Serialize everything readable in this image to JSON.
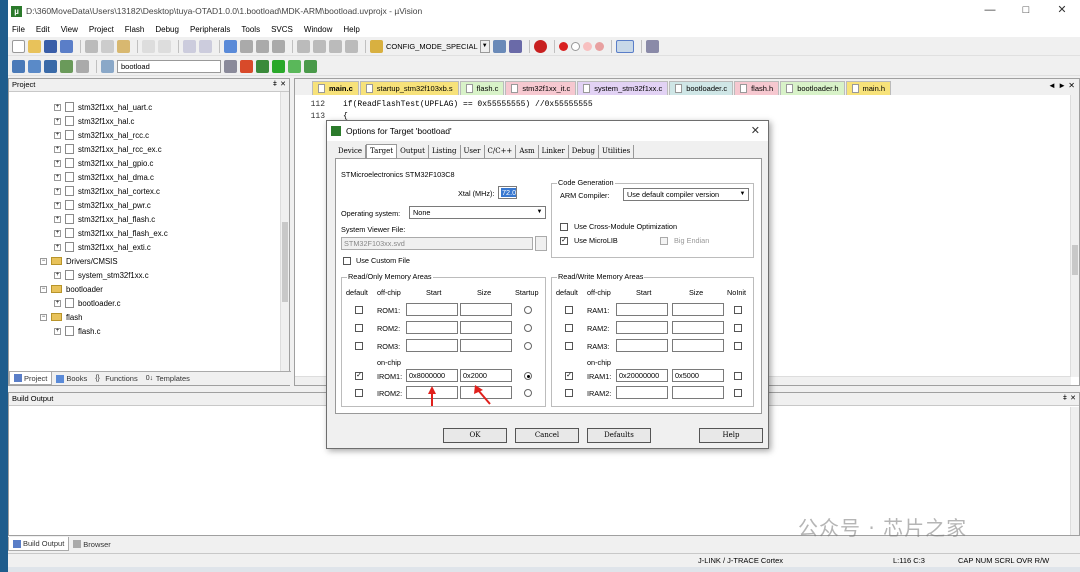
{
  "window": {
    "title": "D:\\360MoveData\\Users\\13182\\Desktop\\tuya-OTAD1.0.0\\1.bootload\\MDK-ARM\\bootload.uvprojx - µVision",
    "controls": [
      "—",
      "□",
      "✕"
    ]
  },
  "menu": [
    "File",
    "Edit",
    "View",
    "Project",
    "Flash",
    "Debug",
    "Peripherals",
    "Tools",
    "SVCS",
    "Window",
    "Help"
  ],
  "toolbar": {
    "config_label": "CONFIG_MODE_SPECIAL",
    "target": "bootload"
  },
  "project": {
    "title": "Project",
    "items": [
      {
        "label": "stm32f1xx_hal_uart.c",
        "kind": "file"
      },
      {
        "label": "stm32f1xx_hal.c",
        "kind": "file"
      },
      {
        "label": "stm32f1xx_hal_rcc.c",
        "kind": "file"
      },
      {
        "label": "stm32f1xx_hal_rcc_ex.c",
        "kind": "file"
      },
      {
        "label": "stm32f1xx_hal_gpio.c",
        "kind": "file"
      },
      {
        "label": "stm32f1xx_hal_dma.c",
        "kind": "file"
      },
      {
        "label": "stm32f1xx_hal_cortex.c",
        "kind": "file"
      },
      {
        "label": "stm32f1xx_hal_pwr.c",
        "kind": "file"
      },
      {
        "label": "stm32f1xx_hal_flash.c",
        "kind": "file"
      },
      {
        "label": "stm32f1xx_hal_flash_ex.c",
        "kind": "file"
      },
      {
        "label": "stm32f1xx_hal_exti.c",
        "kind": "file"
      },
      {
        "label": "Drivers/CMSIS",
        "kind": "folder"
      },
      {
        "label": "system_stm32f1xx.c",
        "kind": "file"
      },
      {
        "label": "bootloader",
        "kind": "folder"
      },
      {
        "label": "bootloader.c",
        "kind": "file"
      },
      {
        "label": "flash",
        "kind": "folder"
      },
      {
        "label": "flash.c",
        "kind": "file"
      }
    ],
    "tabs": [
      "Project",
      "Books",
      "Functions",
      "Templates"
    ]
  },
  "editor": {
    "tabs": [
      {
        "label": "main.c",
        "color": "#f7e27a"
      },
      {
        "label": "startup_stm32f103xb.s",
        "color": "#f7e27a"
      },
      {
        "label": "flash.c",
        "color": "#d8f2c8"
      },
      {
        "label": "stm32f1xx_it.c",
        "color": "#f6c8d0"
      },
      {
        "label": "system_stm32f1xx.c",
        "color": "#e2d2f4"
      },
      {
        "label": "bootloader.c",
        "color": "#cfe6e6"
      },
      {
        "label": "flash.h",
        "color": "#f6c8d0"
      },
      {
        "label": "bootloader.h",
        "color": "#d8f2c8"
      },
      {
        "label": "main.h",
        "color": "#f7e27a"
      }
    ],
    "lines": [
      {
        "num": "112",
        "code": "if(ReadFlashTest(UPFLAG) == 0x55555555)  //0x55555555"
      },
      {
        "num": "113",
        "code": "{"
      }
    ]
  },
  "build": {
    "title": "Build Output",
    "tabs": [
      "Build Output",
      "Browser"
    ]
  },
  "status": {
    "debugger": "J-LINK / J-TRACE Cortex",
    "position": "L:116 C:3",
    "flags": "CAP  NUM  SCRL  OVR  R/W"
  },
  "watermark": "公众号 · 芯片之家",
  "dialog": {
    "title": "Options for Target 'bootload'",
    "tabs": [
      "Device",
      "Target",
      "Output",
      "Listing",
      "User",
      "C/C++",
      "Asm",
      "Linker",
      "Debug",
      "Utilities"
    ],
    "device": "STMicroelectronics STM32F103C8",
    "xtal_label": "Xtal (MHz):",
    "xtal": "72.0",
    "os_label": "Operating system:",
    "os": "None",
    "svd_label": "System Viewer File:",
    "svd": "STM32F103xx.svd",
    "custom_file": "Use Custom File",
    "codegen": {
      "title": "Code Generation",
      "compiler_label": "ARM Compiler:",
      "compiler": "Use default compiler version",
      "cross": "Use Cross-Module Optimization",
      "microlib": "Use MicroLIB",
      "bigendian": "Big Endian"
    },
    "ro": {
      "title": "Read/Only Memory Areas",
      "h_default": "default",
      "h_offchip": "off-chip",
      "h_start": "Start",
      "h_size": "Size",
      "h_startup": "Startup",
      "rows": [
        "ROM1:",
        "ROM2:",
        "ROM3:"
      ],
      "onchip": "on-chip",
      "irom1": "IROM1:",
      "irom1_start": "0x8000000",
      "irom1_size": "0x2000",
      "irom2": "IROM2:"
    },
    "rw": {
      "title": "Read/Write Memory Areas",
      "h_default": "default",
      "h_offchip": "off-chip",
      "h_start": "Start",
      "h_size": "Size",
      "h_noinit": "NoInit",
      "rows": [
        "RAM1:",
        "RAM2:",
        "RAM3:"
      ],
      "onchip": "on-chip",
      "iram1": "IRAM1:",
      "iram1_start": "0x20000000",
      "iram1_size": "0x5000",
      "iram2": "IRAM2:"
    },
    "buttons": {
      "ok": "OK",
      "cancel": "Cancel",
      "defaults": "Defaults",
      "help": "Help"
    }
  }
}
